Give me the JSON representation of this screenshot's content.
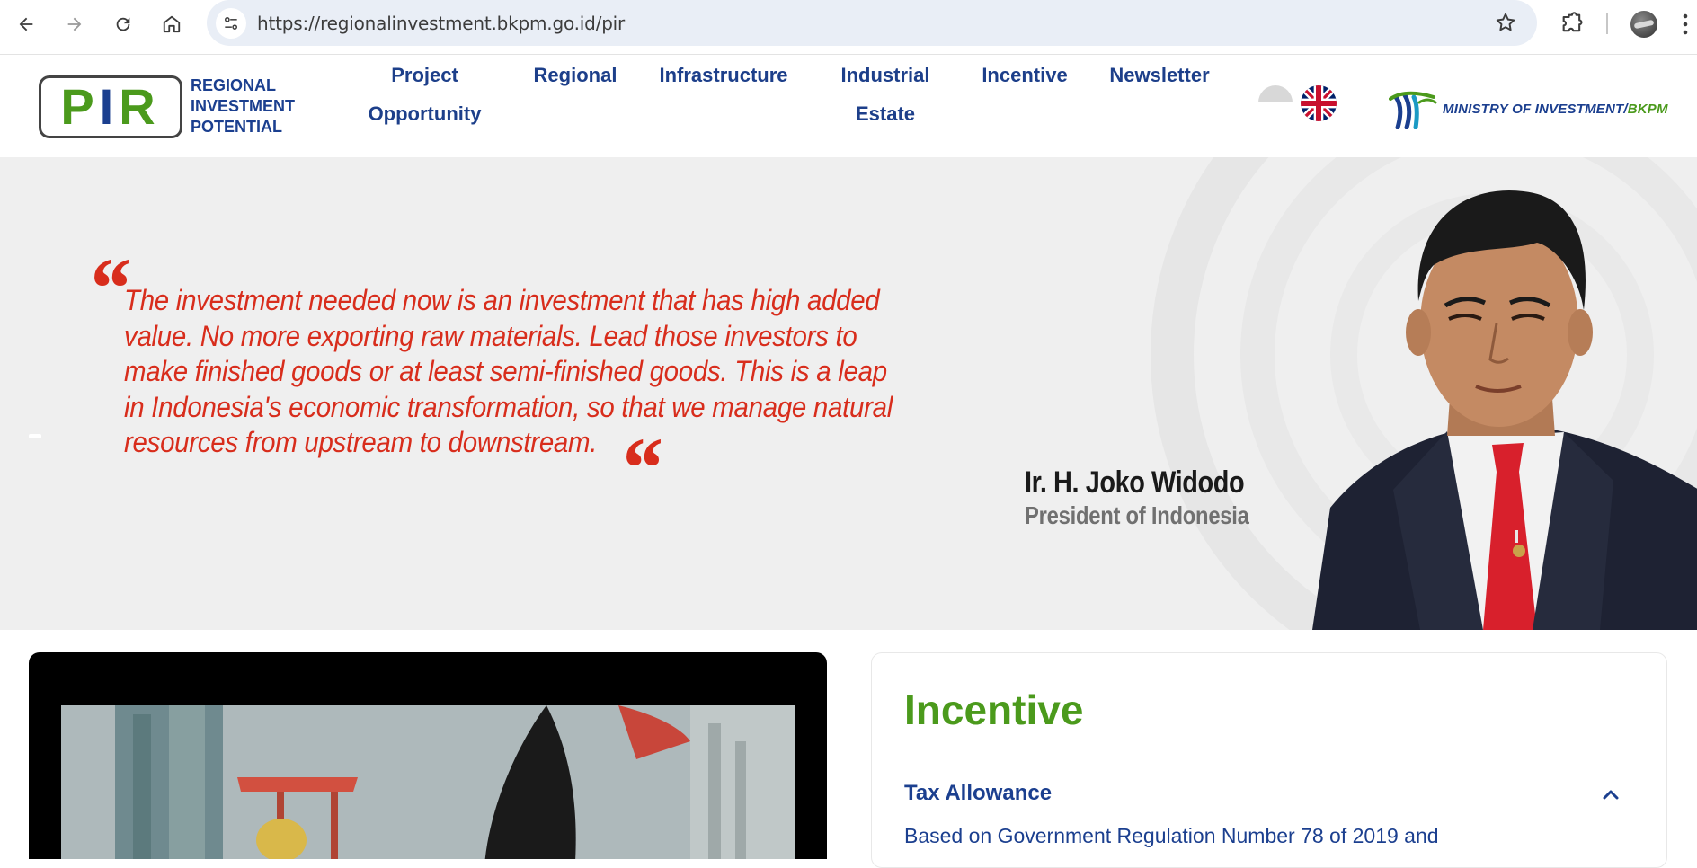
{
  "browser": {
    "url": "https://regionalinvestment.bkpm.go.id/pir",
    "icons": [
      "back-icon",
      "forward-icon",
      "reload-icon",
      "home-icon",
      "site-info-icon",
      "bookmark-star-icon",
      "extensions-icon",
      "profile-avatar",
      "more-menu-icon"
    ]
  },
  "header": {
    "logo_letters": [
      "P",
      "I",
      "R"
    ],
    "logo_caption": [
      "REGIONAL",
      "INVESTMENT",
      "POTENTIAL"
    ],
    "nav": [
      {
        "line1": "Project",
        "line2": "Opportunity"
      },
      {
        "line1": "Regional",
        "line2": ""
      },
      {
        "line1": "Infrastructure",
        "line2": ""
      },
      {
        "line1": "Industrial",
        "line2": "Estate"
      },
      {
        "line1": "Incentive",
        "line2": ""
      },
      {
        "line1": "Newsletter",
        "line2": ""
      }
    ],
    "ministry_main": "MINISTRY OF INVESTMENT/",
    "ministry_bkpm": "BKPM"
  },
  "hero": {
    "quote": "The investment needed now is an investment that has high added value. No more exporting raw materials. Lead those investors to make finished goods or at least semi-finished goods. This is a leap in Indonesia's economic transformation, so that we manage natural resources from upstream to downstream.",
    "speaker_name": "Ir. H. Joko Widodo",
    "speaker_role": "President of Indonesia"
  },
  "incentive": {
    "title": "Incentive",
    "item_title": "Tax Allowance",
    "item_body": "Based on Government Regulation Number 78 of 2019 and"
  },
  "colors": {
    "brand_blue": "#1b3f8f",
    "brand_green": "#4b9a1c",
    "quote_red": "#d82d1c",
    "hero_bg": "#efefef"
  }
}
